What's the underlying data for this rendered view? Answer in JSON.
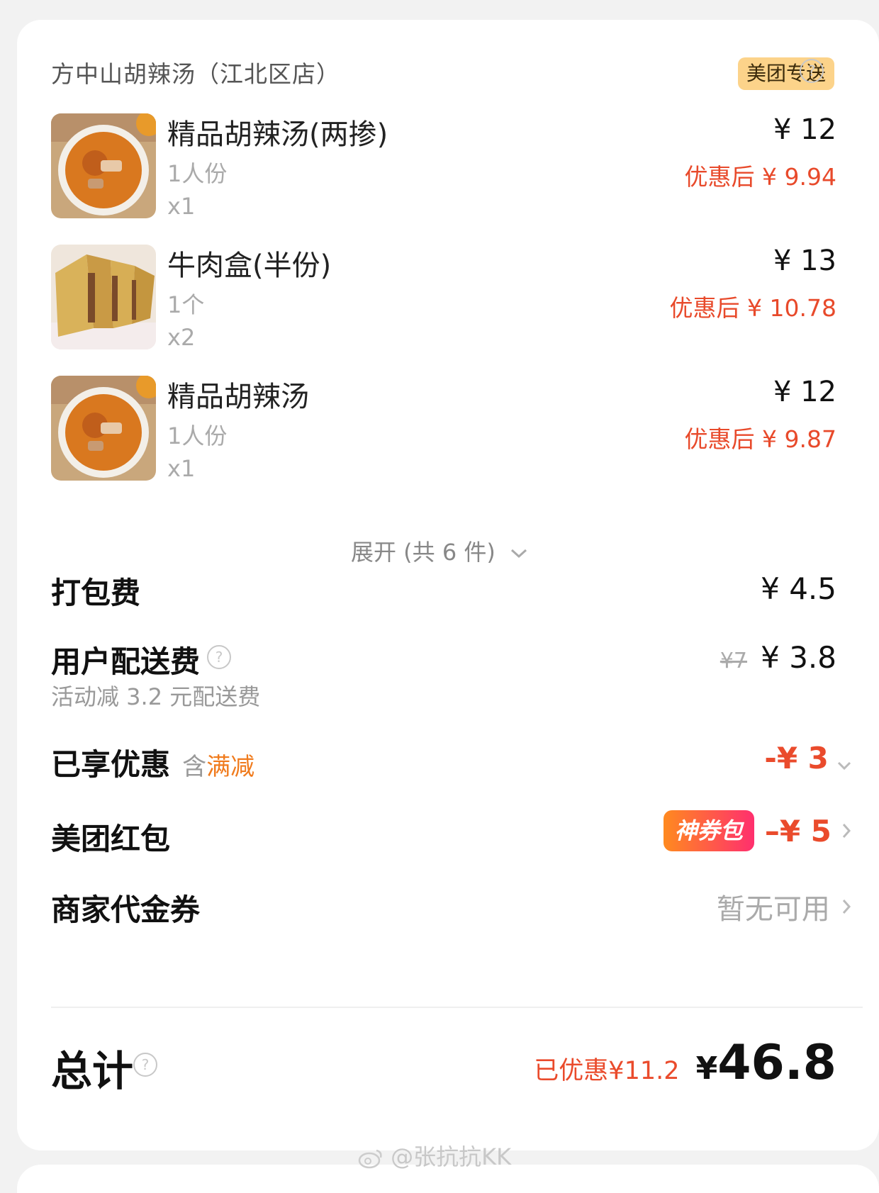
{
  "shop": {
    "name": "方中山胡辣汤（江北区店）",
    "badge": "美团专送",
    "help": "?"
  },
  "items": [
    {
      "name": "精品胡辣汤(两掺)",
      "spec": "1人份",
      "qty": "x1",
      "price": "¥ 12",
      "discounted": "优惠后 ¥ 9.94",
      "thumb_icon": "spicy-soup-bowl"
    },
    {
      "name": "牛肉盒(半份)",
      "spec": "1个",
      "qty": "x2",
      "price": "¥ 13",
      "discounted": "优惠后 ¥ 10.78",
      "thumb_icon": "beef-pie"
    },
    {
      "name": "精品胡辣汤",
      "spec": "1人份",
      "qty": "x1",
      "price": "¥ 12",
      "discounted": "优惠后 ¥ 9.87",
      "thumb_icon": "spicy-soup-bowl"
    }
  ],
  "expand": {
    "label": "展开 (共 6 件)",
    "icon": "chevron-down-icon"
  },
  "packing": {
    "label": "打包费",
    "value": "¥ 4.5"
  },
  "delivery": {
    "label": "用户配送费",
    "note": "活动减 3.2 元配送费",
    "original": "¥7",
    "value": "¥ 3.8",
    "help": "?"
  },
  "discount": {
    "label": "已享优惠",
    "tag_prefix": "含",
    "tag": "满减",
    "value": "-¥ 3"
  },
  "redpacket": {
    "label": "美团红包",
    "badge": "神券包",
    "value": "–¥ 5"
  },
  "voucher": {
    "label": "商家代金券",
    "value": "暂无可用"
  },
  "total": {
    "label": "总计",
    "help": "?",
    "saved": "已优惠¥11.2",
    "currency": "¥",
    "amount": "46.8"
  },
  "watermark": "@张抗抗KK",
  "colors": {
    "accent_red": "#ea4b2c",
    "accent_orange": "#f07b1d",
    "badge_bg": "#fcd38a"
  }
}
